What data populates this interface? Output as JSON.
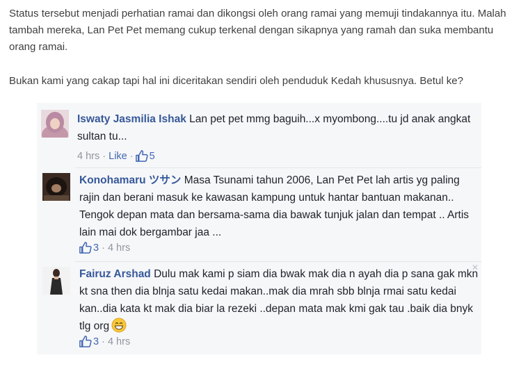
{
  "article": {
    "paragraph1": "Status tersebut menjadi perhatian ramai dan dikongsi oleh orang ramai yang memuji tindakannya itu. Malah tambah mereka, Lan Pet Pet memang cukup terkenal dengan sikapnya yang ramah dan suka membantu orang ramai.",
    "paragraph2": "Bukan kami yang cakap tapi hal ini diceritakan sendiri oleh penduduk Kedah khususnya. Betul ke?"
  },
  "comments": [
    {
      "name": "Iswaty Jasmilia Ishak",
      "text": "Lan pet pet mmg baguih...x myombong....tu jd anak angkat sultan tu...",
      "time": "4 hrs",
      "like_label": "Like",
      "likes": "5"
    },
    {
      "name": "Konohamaru ツサン",
      "text": "Masa Tsunami tahun 2006, Lan Pet Pet lah artis yg paling rajin dan berani masuk ke kawasan kampung untuk hantar bantuan makanan.. Tengok depan mata dan bersama-sama dia bawak tunjuk jalan dan tempat .. Artis lain mai dok bergambar jaa ...",
      "likes": "3",
      "time": "4 hrs"
    },
    {
      "name": "Fairuz Arshad",
      "text": "Dulu mak kami p siam dia bwak mak dia n ayah dia p sana gak mkn kt sna then dia blnja satu kedai makan..mak dia mrah sbb blnja rmai satu kedai kan..dia kata kt mak dia biar la rezeki ..depan mata mak kmi gak tau .baik dia bnyk tlg org",
      "likes": "3",
      "time": "4 hrs",
      "emoji": "grinning-emoji"
    }
  ],
  "colors": {
    "name_link": "#365899",
    "action_link": "#4267b2",
    "meta_gray": "#90949c",
    "box_bg": "#f6f7f9"
  }
}
